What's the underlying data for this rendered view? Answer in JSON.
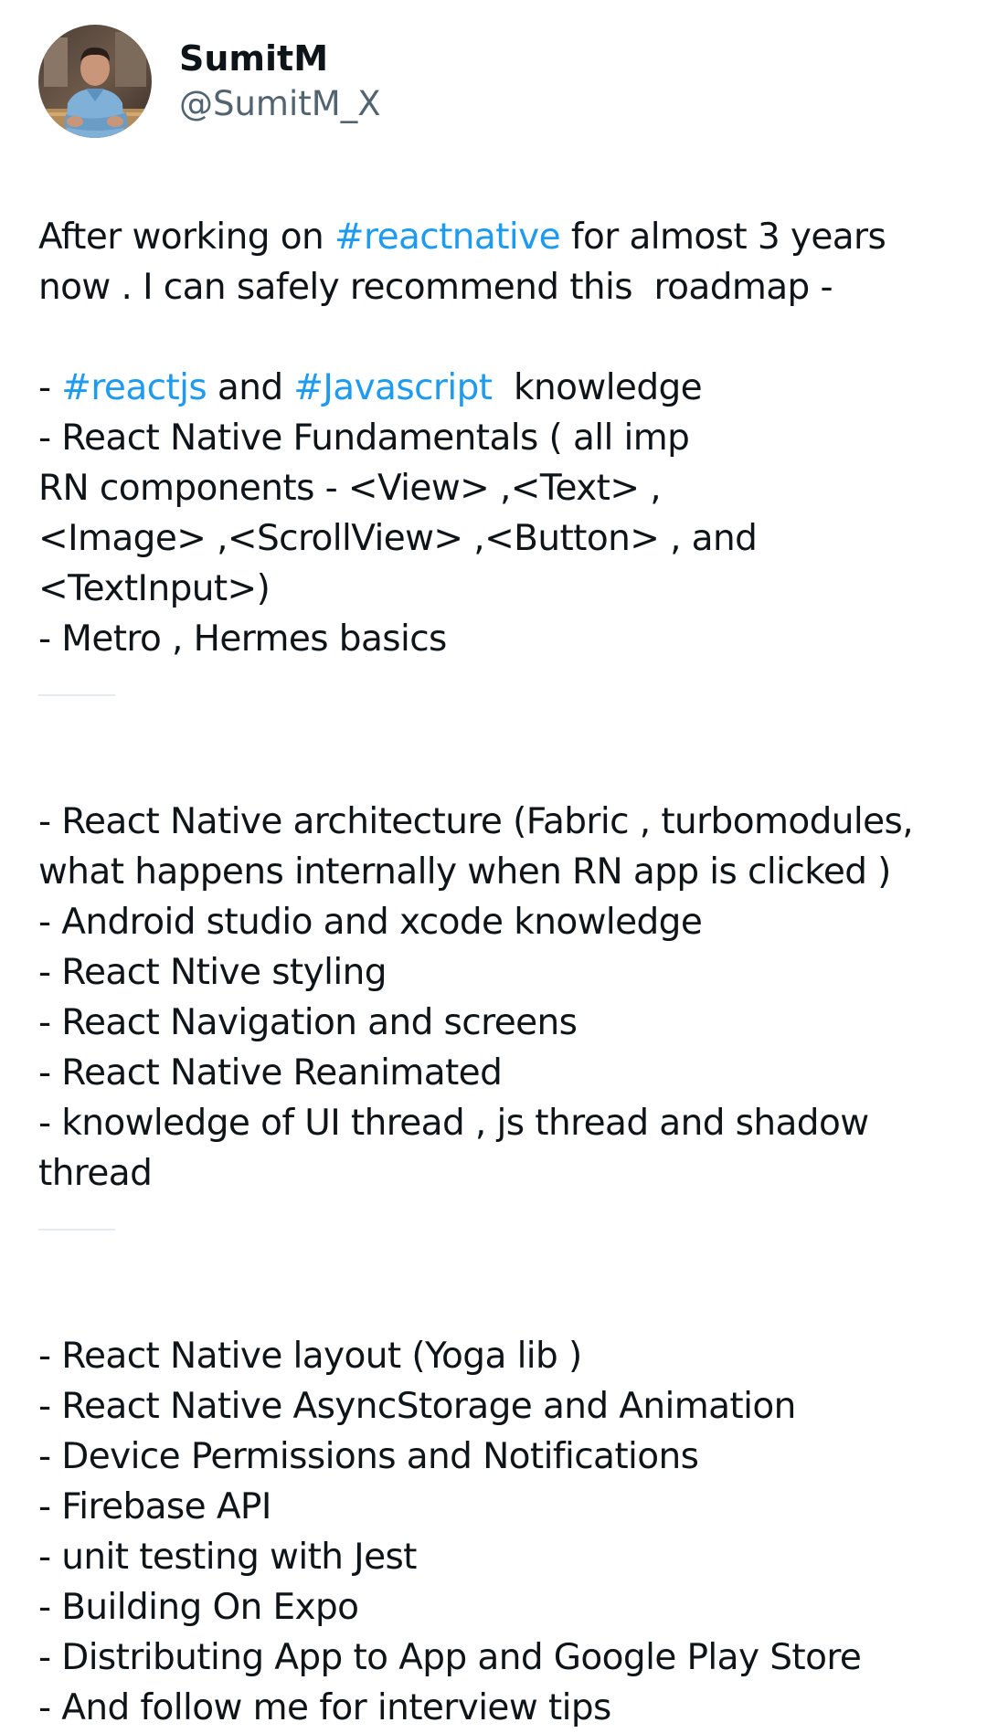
{
  "author": {
    "display_name": "SumitM",
    "handle": "@SumitM_X"
  },
  "intro": {
    "l1_a": "After working on ",
    "l1_tag": "#reactnative",
    "l1_b": " for almost 3 years",
    "l2": "now . I can safely recommend this  roadmap -"
  },
  "section1": {
    "l1_a": "- ",
    "tag_reactjs": "#reactjs",
    "l1_and": " and ",
    "tag_javascript": "#Javascript",
    "l1_b": "  knowledge",
    "l2": "- React Native Fundamentals ( all imp",
    "l3": "RN components - <View> ,<Text> ,",
    "l4": "<Image> ,<ScrollView> ,<Button> , and",
    "l5": "<TextInput>)",
    "l6": "- Metro , Hermes basics"
  },
  "section2": {
    "l1": "- React Native architecture (Fabric , turbomodules,",
    "l2": "what happens internally when RN app is clicked )",
    "l3": "- Android studio and xcode knowledge",
    "l4": "- React Ntive styling",
    "l5": "- React Navigation and screens",
    "l6": "- React Native Reanimated",
    "l7": "- knowledge of UI thread , js thread and shadow",
    "l8": "thread"
  },
  "section3": {
    "l1": "- React Native layout (Yoga lib )",
    "l2": "- React Native AsyncStorage and Animation",
    "l3": "- Device Permissions and Notifications",
    "l4": "- Firebase API",
    "l5": "- unit testing with Jest",
    "l6": "- Building On Expo",
    "l7": "- Distributing App to App and Google Play Store",
    "l8": "- And follow me for interview tips"
  },
  "colors": {
    "text": "#0f1419",
    "handle": "#536471",
    "hashtag": "#1d9bf0",
    "divider": "#e6eaed"
  },
  "icons": {
    "avatar": "profile-photo"
  }
}
